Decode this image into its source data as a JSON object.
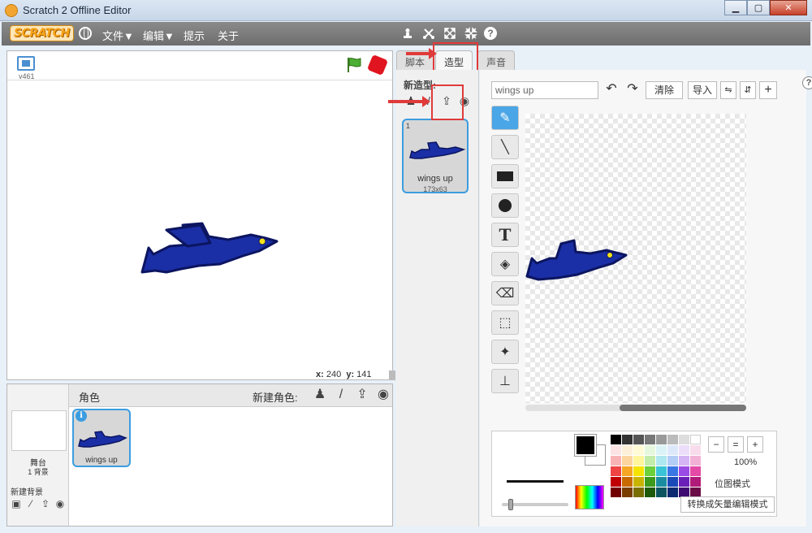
{
  "window": {
    "title": "Scratch 2 Offline Editor",
    "minimize": "▁",
    "maximize": "▢",
    "close": "✕"
  },
  "menubar": {
    "logo": "SCRATCH",
    "file": "文件▼",
    "edit": "编辑▼",
    "tips": "提示",
    "about": "关于",
    "tools": [
      {
        "name": "duplicate-icon",
        "glyph": "⍝"
      },
      {
        "name": "cut-icon",
        "glyph": "✂"
      },
      {
        "name": "grow-icon",
        "glyph": "✕"
      },
      {
        "name": "shrink-icon",
        "glyph": "✕"
      }
    ],
    "help": "?"
  },
  "stage": {
    "version": "v461",
    "coords": {
      "x_label": "x:",
      "x": "240",
      "y_label": "y:",
      "y": "141"
    }
  },
  "sprites": {
    "title": "角色",
    "new_sprite_label": "新建角色:",
    "stage_label": "舞台",
    "stage_count": "1 背景",
    "new_backdrop": "新建背景",
    "sprite_name": "wings up",
    "info": "i"
  },
  "tabs": {
    "scripts": "脚本",
    "costumes": "造型",
    "sounds": "声音"
  },
  "costumes": {
    "new_costume": "新造型:",
    "items": [
      {
        "num": "1",
        "name": "wings up",
        "size": "173x63"
      }
    ]
  },
  "editor": {
    "costume_name": "wings up",
    "clear": "清除",
    "import": "导入",
    "zoom_pct": "100%",
    "mode": "位图模式",
    "convert": "转换成矢量编辑模式",
    "help": "?"
  },
  "colors": {
    "accent": "#3b9de0",
    "bird_body": "#1a2fa6",
    "bird_outline": "#0c1560",
    "bird_eye": "#f4e21a",
    "annotation": "#e03a3a"
  }
}
